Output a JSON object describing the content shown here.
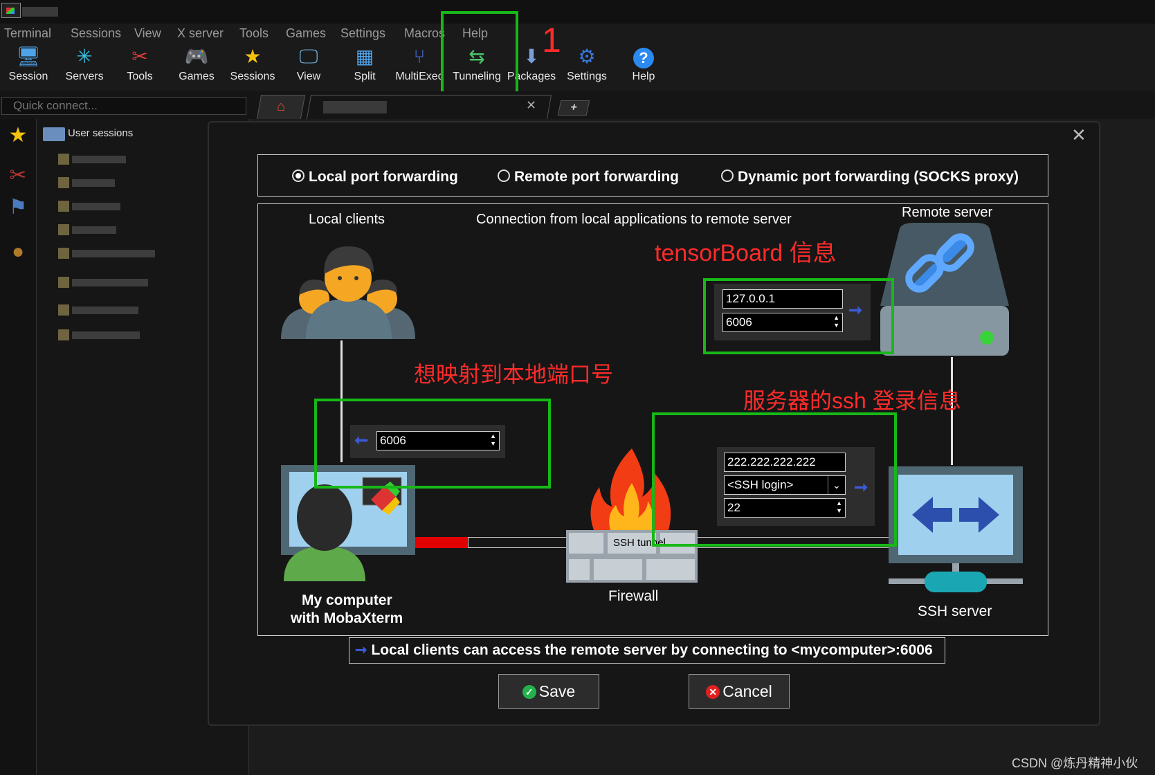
{
  "menu": [
    "Terminal",
    "Sessions",
    "View",
    "X server",
    "Tools",
    "Games",
    "Settings",
    "Macros",
    "Help"
  ],
  "toolbar": [
    {
      "label": "Session",
      "icon": "monitor-icon"
    },
    {
      "label": "Servers",
      "icon": "servers-icon"
    },
    {
      "label": "Tools",
      "icon": "tools-icon"
    },
    {
      "label": "Games",
      "icon": "gamepad-icon"
    },
    {
      "label": "Sessions",
      "icon": "star-icon"
    },
    {
      "label": "View",
      "icon": "view-icon"
    },
    {
      "label": "Split",
      "icon": "split-icon"
    },
    {
      "label": "MultiExec",
      "icon": "multiexec-icon"
    },
    {
      "label": "Tunneling",
      "icon": "tunneling-icon"
    },
    {
      "label": "Packages",
      "icon": "packages-icon"
    },
    {
      "label": "Settings",
      "icon": "gears-icon"
    },
    {
      "label": "Help",
      "icon": "help-icon"
    }
  ],
  "quick_connect_placeholder": "Quick connect...",
  "sidebar": {
    "root": "User sessions"
  },
  "dialog": {
    "modes": [
      {
        "label": "Local port forwarding",
        "selected": true
      },
      {
        "label": "Remote port forwarding",
        "selected": false
      },
      {
        "label": "Dynamic port forwarding (SOCKS proxy)",
        "selected": false
      }
    ],
    "local_clients": "Local clients",
    "connection_caption": "Connection from local applications to remote server",
    "remote_server": "Remote server",
    "remote_host": "127.0.0.1",
    "remote_port": "6006",
    "local_port": "6006",
    "ssh_host": "222.222.222.222",
    "ssh_login": "<SSH login>",
    "ssh_port": "22",
    "ssh_tunnel": "SSH tunnel",
    "firewall": "Firewall",
    "my_computer_line1": "My computer",
    "my_computer_line2": "with MobaXterm",
    "ssh_server": "SSH server",
    "info": "Local clients can access the remote server by connecting to <mycomputer>:6006",
    "save": "Save",
    "cancel": "Cancel"
  },
  "annotations": {
    "step": "1",
    "tensorboard": "tensorBoard  信息",
    "local_port_note": "想映射到本地端口号",
    "ssh_note": "服务器的ssh 登录信息",
    "highlight_color": "#17b817",
    "text_color": "#ff2b2b"
  },
  "watermark": "CSDN @炼丹精神小伙"
}
